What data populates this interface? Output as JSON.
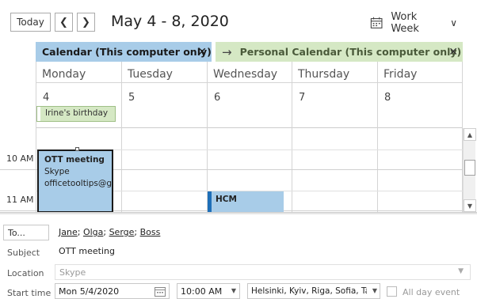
{
  "toolbar": {
    "today_label": "Today",
    "date_range": "May 4 - 8, 2020",
    "view_label": "Work Week"
  },
  "calendars": [
    {
      "label": "Calendar (This computer only)",
      "color": "#a8cce8"
    },
    {
      "label": "Personal Calendar (This computer only)",
      "color": "#d5e8c4"
    }
  ],
  "days": [
    {
      "name": "Monday",
      "num": "4"
    },
    {
      "name": "Tuesday",
      "num": "5"
    },
    {
      "name": "Wednesday",
      "num": "6"
    },
    {
      "name": "Thursday",
      "num": "7"
    },
    {
      "name": "Friday",
      "num": "8"
    }
  ],
  "allday_event": {
    "title": "Irine's birthday"
  },
  "time_labels": [
    "10 AM",
    "11 AM"
  ],
  "events": [
    {
      "title": "OTT meeting",
      "line2": "Skype",
      "line3": "officetooltips@gn"
    },
    {
      "title": "HCM"
    }
  ],
  "form": {
    "to_button": "To...",
    "recipients": [
      "Jane",
      "Olga",
      "Serge",
      "Boss"
    ],
    "subject_label": "Subject",
    "subject_value": "OTT meeting",
    "location_label": "Location",
    "location_value": "Skype",
    "start_label": "Start time",
    "start_date": "Mon 5/4/2020",
    "start_time": "10:00 AM",
    "timezone": "Helsinki, Kyiv, Riga, Sofia, Tallinn",
    "allday_label": "All day event"
  }
}
